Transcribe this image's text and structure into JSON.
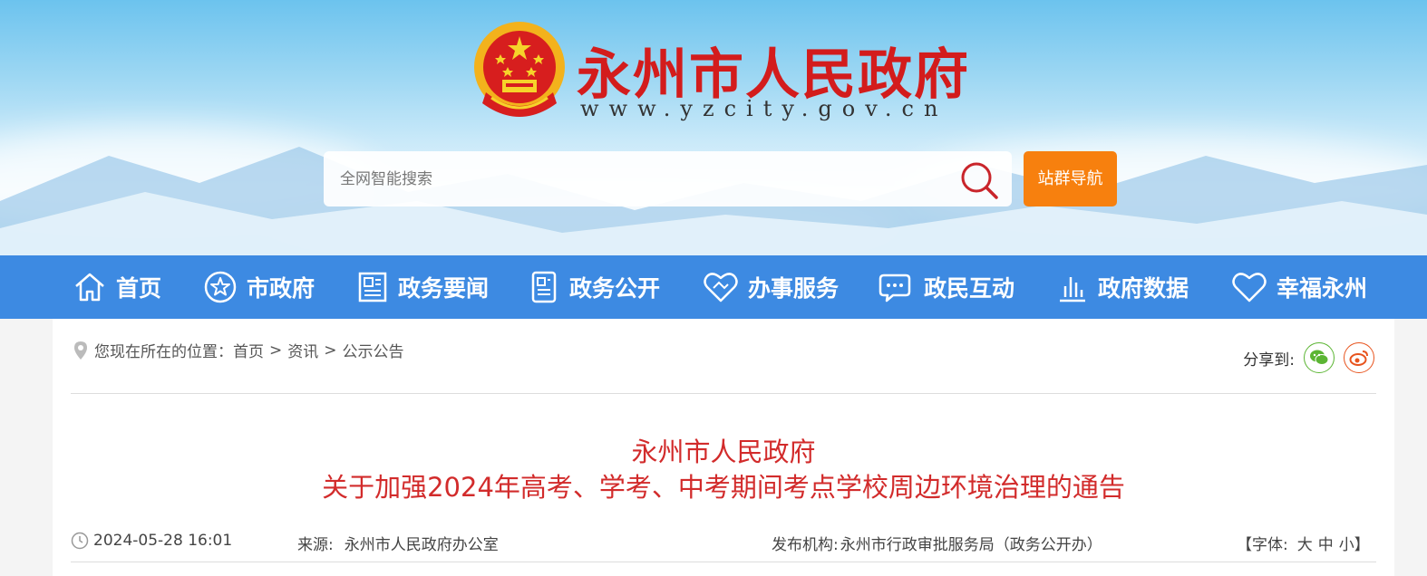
{
  "header": {
    "site_title": "永州市人民政府",
    "site_url": "www.yzcity.gov.cn",
    "search": {
      "placeholder": "全网智能搜索",
      "value": ""
    },
    "site_nav_label": "站群导航"
  },
  "nav": {
    "items": [
      {
        "label": "首页",
        "icon": "home-icon"
      },
      {
        "label": "市政府",
        "icon": "star-circle-icon"
      },
      {
        "label": "政务要闻",
        "icon": "news-icon"
      },
      {
        "label": "政务公开",
        "icon": "document-icon"
      },
      {
        "label": "办事服务",
        "icon": "handshake-heart-icon"
      },
      {
        "label": "政民互动",
        "icon": "chat-icon"
      },
      {
        "label": "政府数据",
        "icon": "bar-chart-icon"
      },
      {
        "label": "幸福永州",
        "icon": "heart-icon"
      }
    ]
  },
  "breadcrumb": {
    "prefix": "您现在所在的位置：",
    "items": [
      "首页",
      "资讯",
      "公示公告"
    ],
    "separator": ">"
  },
  "share": {
    "label": "分享到:",
    "targets": [
      {
        "icon": "wechat-icon",
        "color": "#5bb533"
      },
      {
        "icon": "weibo-icon",
        "color": "#e8541e"
      }
    ]
  },
  "article": {
    "title_line1": "永州市人民政府",
    "title_line2": "关于加强2024年高考、学考、中考期间考点学校周边环境治理的通告",
    "datetime": "2024-05-28 16:01",
    "source_label": "来源:",
    "source_value": "永州市人民政府办公室",
    "publisher_label": "发布机构:",
    "publisher_value": "永州市行政审批服务局（政务公开办）",
    "font_size_label": "【字体:",
    "font_sizes": [
      "大",
      "中",
      "小"
    ],
    "font_size_close": "】"
  },
  "colors": {
    "brand_red": "#d31c1c",
    "nav_blue": "#3d8ae2",
    "accent_orange": "#f7800e",
    "title_red": "#d22b2b"
  }
}
